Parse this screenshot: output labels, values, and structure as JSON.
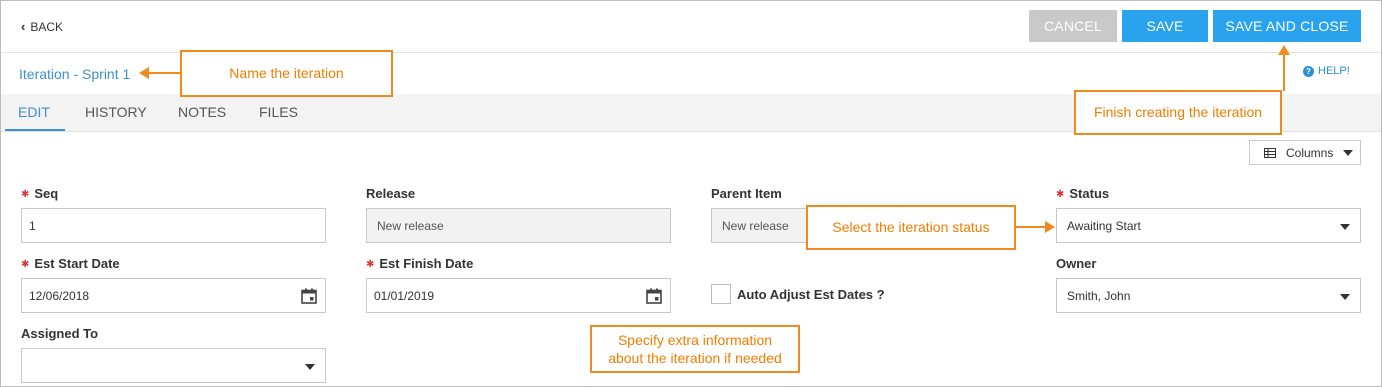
{
  "header": {
    "back_label": "BACK",
    "cancel_label": "CANCEL",
    "save_label": "SAVE",
    "save_close_label": "SAVE AND CLOSE"
  },
  "item_title": "Iteration - Sprint 1",
  "help_label": "HELP!",
  "tabs": [
    {
      "label": "EDIT",
      "active": true
    },
    {
      "label": "HISTORY"
    },
    {
      "label": "NOTES"
    },
    {
      "label": "FILES"
    }
  ],
  "columns_label": "Columns",
  "fields": {
    "seq": {
      "label": "Seq",
      "value": "1"
    },
    "release": {
      "label": "Release",
      "value": "New release"
    },
    "parent_item": {
      "label": "Parent Item",
      "value": "New release"
    },
    "status": {
      "label": "Status",
      "value": "Awaiting Start"
    },
    "est_start_date": {
      "label": "Est Start Date",
      "value": "12/06/2018"
    },
    "est_finish_date": {
      "label": "Est Finish Date",
      "value": "01/01/2019"
    },
    "auto_adjust": {
      "label": "Auto Adjust Est Dates ?",
      "checked": false
    },
    "owner": {
      "label": "Owner",
      "value": "Smith, John"
    },
    "assigned_to": {
      "label": "Assigned To",
      "value": ""
    }
  },
  "annotations": {
    "name": "Name the iteration",
    "finish": "Finish creating the iteration",
    "status": "Select the iteration status",
    "extra_line1": "Specify extra information",
    "extra_line2": "about the iteration if needed"
  },
  "colors": {
    "accent": "#2aa3ef",
    "link": "#3e8fce",
    "callout": "#f08a1d",
    "required": "#dd3333",
    "cancel_bg": "#c9c9c9"
  }
}
